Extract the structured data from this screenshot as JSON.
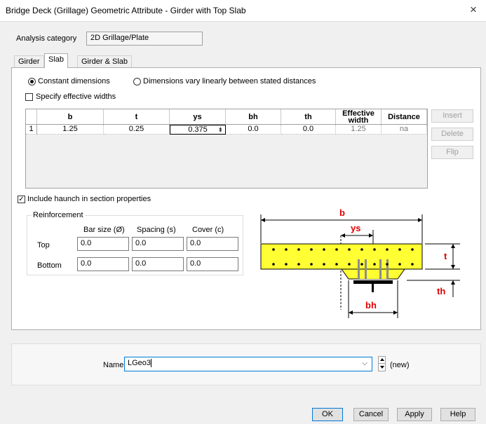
{
  "window": {
    "title": "Bridge Deck (Grillage) Geometric Attribute - Girder with Top Slab",
    "close_glyph": "×"
  },
  "analysis": {
    "label": "Analysis category",
    "value": "2D Grillage/Plate"
  },
  "tabs": [
    {
      "label": "Girder"
    },
    {
      "label": "Slab"
    },
    {
      "label": "Girder & Slab"
    }
  ],
  "options": {
    "constant": "Constant dimensions",
    "vary": "Dimensions vary linearly between stated distances",
    "specify_widths": "Specify effective widths"
  },
  "table": {
    "headers": [
      "b",
      "t",
      "ys",
      "bh",
      "th",
      "Effective width",
      "Distance"
    ],
    "rows": [
      {
        "index": "1",
        "cells": [
          "1.25",
          "0.25",
          "0.375",
          "0.0",
          "0.0",
          "1.25",
          "na"
        ]
      }
    ]
  },
  "side_buttons": {
    "insert": "Insert",
    "delete": "Delete",
    "flip": "Flip"
  },
  "haunch": "Include haunch in section properties",
  "reinforcement": {
    "title": "Reinforcement",
    "columns": [
      "Bar size (Ø)",
      "Spacing (s)",
      "Cover (c)"
    ],
    "rows": [
      {
        "label": "Top",
        "values": [
          "0.0",
          "0.0",
          "0.0"
        ]
      },
      {
        "label": "Bottom",
        "values": [
          "0.0",
          "0.0",
          "0.0"
        ]
      }
    ]
  },
  "diagram": {
    "b": "b",
    "ys": "ys",
    "t": "t",
    "th": "th",
    "bh": "bh",
    "slab_color": "#ffff33",
    "label_color": "#e00000"
  },
  "name": {
    "label": "Name",
    "value": "LGeo3",
    "status": "(new)"
  },
  "footer": {
    "ok": "OK",
    "cancel": "Cancel",
    "apply": "Apply",
    "help": "Help"
  }
}
